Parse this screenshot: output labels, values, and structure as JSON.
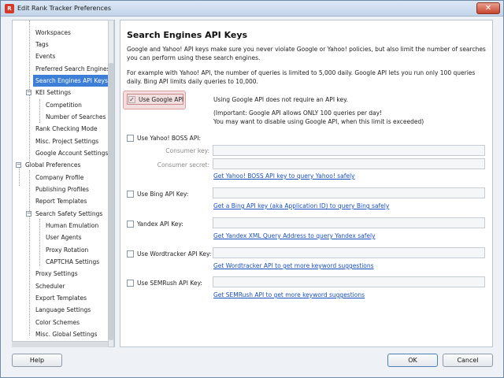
{
  "window": {
    "title": "Edit Rank Tracker Preferences",
    "close_glyph": "✕",
    "app_icon_glyph": "R"
  },
  "sidebar": {
    "items": [
      {
        "label": "Workspaces",
        "level": 1
      },
      {
        "label": "Tags",
        "level": 1
      },
      {
        "label": "Events",
        "level": 1
      },
      {
        "label": "Preferred Search Engines",
        "level": 1
      },
      {
        "label": "Search Engines API Keys",
        "level": 1,
        "selected": true
      },
      {
        "label": "KEI Settings",
        "level": 1,
        "expandable": true
      },
      {
        "label": "Competition",
        "level": 2
      },
      {
        "label": "Number of Searches",
        "level": 2
      },
      {
        "label": "Rank Checking Mode",
        "level": 1
      },
      {
        "label": "Misc. Project Settings",
        "level": 1
      },
      {
        "label": "Google Account Settings",
        "level": 1
      },
      {
        "label": "Global Preferences",
        "level": 0,
        "expandable": true
      },
      {
        "label": "Company Profile",
        "level": 1
      },
      {
        "label": "Publishing Profiles",
        "level": 1
      },
      {
        "label": "Report Templates",
        "level": 1
      },
      {
        "label": "Search Safety Settings",
        "level": 1,
        "expandable": true
      },
      {
        "label": "Human Emulation",
        "level": 2
      },
      {
        "label": "User Agents",
        "level": 2
      },
      {
        "label": "Proxy Rotation",
        "level": 2
      },
      {
        "label": "CAPTCHA Settings",
        "level": 2
      },
      {
        "label": "Proxy Settings",
        "level": 1
      },
      {
        "label": "Scheduler",
        "level": 1
      },
      {
        "label": "Export Templates",
        "level": 1
      },
      {
        "label": "Language Settings",
        "level": 1
      },
      {
        "label": "Color Schemes",
        "level": 1
      },
      {
        "label": "Misc. Global Settings",
        "level": 1
      }
    ]
  },
  "main": {
    "heading": "Search Engines API Keys",
    "intro": "Google and Yahoo! API keys make sure you never violate Google or Yahoo! policies, but also limit the number of searches you can perform using these search engines.",
    "example": "For example with Yahoo! API, the number of queries is limited to 5,000 daily. Google API lets you run only 100 queries daily. Bing API limits daily queries to 10,000.",
    "google": {
      "label": "Use Google API",
      "checked": true,
      "check_glyph": "✓",
      "info1": "Using Google API does not require an API key.",
      "info2": "(Important: Google API allows ONLY 100 queries per day!",
      "info3": "You may want to disable using Google API, when this limit is exceeded)"
    },
    "yahoo": {
      "label": "Use Yahoo! BOSS API:",
      "consumer_key_label": "Consumer key:",
      "consumer_secret_label": "Consumer secret:",
      "consumer_key_value": "",
      "consumer_secret_value": "",
      "link": "Get Yahoo! BOSS API key to query Yahoo! safely"
    },
    "bing": {
      "label": "Use Bing API Key:",
      "value": "",
      "link": "Get a Bing API key (aka Application ID) to query Bing safely"
    },
    "yandex": {
      "label": "Yandex API Key:",
      "value": "",
      "link": "Get Yandex XML Query Address to query Yandex safely"
    },
    "wordtracker": {
      "label": "Use Wordtracker API Key:",
      "value": "",
      "link": "Get Wordtracker API to get more keyword suggestions"
    },
    "semrush": {
      "label": "Use SEMRush API Key:",
      "value": "",
      "link": "Get SEMRush API to get more keyword suggestions"
    }
  },
  "footer": {
    "help_label": "Help",
    "ok_label": "OK",
    "cancel_label": "Cancel"
  },
  "colors": {
    "selection": "#3d7fd6",
    "link": "#1a4fbf",
    "google_highlight": "#f2dede"
  }
}
